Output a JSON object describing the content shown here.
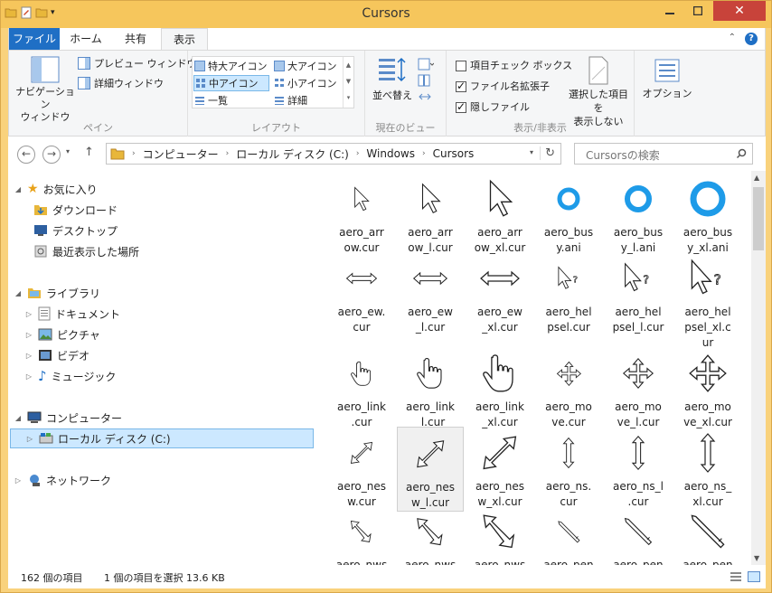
{
  "window": {
    "title": "Cursors"
  },
  "tabs": {
    "file": "ファイル",
    "home": "ホーム",
    "share": "共有",
    "view": "表示"
  },
  "ribbon": {
    "pane": {
      "nav_pane": "ナビゲーション\nウィンドウ",
      "preview": "プレビュー ウィンドウ",
      "details": "詳細ウィンドウ",
      "label": "ペイン"
    },
    "layout": {
      "items": [
        "特大アイコン",
        "大アイコン",
        "中アイコン",
        "小アイコン",
        "一覧",
        "詳細"
      ],
      "label": "レイアウト"
    },
    "current_view": {
      "sort": "並べ替え",
      "label": "現在のビュー"
    },
    "show_hide": {
      "item_checkbox": "項目チェック ボックス",
      "extensions": "ファイル名拡張子",
      "hidden": "隠しファイル",
      "hide_selected": "選択した項目を\n表示しない",
      "label": "表示/非表示"
    },
    "options": "オプション"
  },
  "address": {
    "crumbs": [
      "コンピューター",
      "ローカル ディスク (C:)",
      "Windows",
      "Cursors"
    ],
    "search_placeholder": "Cursorsの検索"
  },
  "nav": {
    "favorites": "お気に入り",
    "downloads": "ダウンロード",
    "desktop": "デスクトップ",
    "recent": "最近表示した場所",
    "libraries": "ライブラリ",
    "documents": "ドキュメント",
    "pictures": "ピクチャ",
    "videos": "ビデオ",
    "music": "ミュージック",
    "computer": "コンピューター",
    "local_disk": "ローカル ディスク (C:)",
    "network": "ネットワーク"
  },
  "files": [
    [
      "aero_arr",
      "ow.cur"
    ],
    [
      "aero_arr",
      "ow_l.cur"
    ],
    [
      "aero_arr",
      "ow_xl.cur"
    ],
    [
      "aero_bus",
      "y.ani"
    ],
    [
      "aero_bus",
      "y_l.ani"
    ],
    [
      "aero_bus",
      "y_xl.ani"
    ],
    [
      "aero_ew.",
      "cur"
    ],
    [
      "aero_ew",
      "_l.cur"
    ],
    [
      "aero_ew",
      "_xl.cur"
    ],
    [
      "aero_hel",
      "psel.cur"
    ],
    [
      "aero_hel",
      "psel_l.cur"
    ],
    [
      "aero_hel",
      "psel_xl.c",
      "ur"
    ],
    [
      "aero_link",
      ".cur"
    ],
    [
      "aero_link",
      "_l.cur"
    ],
    [
      "aero_link",
      "_xl.cur"
    ],
    [
      "aero_mo",
      "ve.cur"
    ],
    [
      "aero_mo",
      "ve_l.cur"
    ],
    [
      "aero_mo",
      "ve_xl.cur"
    ],
    [
      "aero_nes",
      "w.cur"
    ],
    [
      "aero_nes",
      "w_l.cur"
    ],
    [
      "aero_nes",
      "w_xl.cur"
    ],
    [
      "aero_ns.",
      "cur"
    ],
    [
      "aero_ns_l",
      ".cur"
    ],
    [
      "aero_ns_",
      "xl.cur"
    ],
    [
      "aero_nws"
    ],
    [
      "aero_nws"
    ],
    [
      "aero_nws"
    ],
    [
      "aero_pen"
    ],
    [
      "aero_pen"
    ],
    [
      "aero_pen"
    ]
  ],
  "status": {
    "count": "162 個の項目",
    "selected": "1 個の項目を選択  13.6 KB"
  },
  "colors": {
    "accent": "#1f6fc5",
    "frame": "#f6c65c",
    "close": "#c8433a"
  }
}
